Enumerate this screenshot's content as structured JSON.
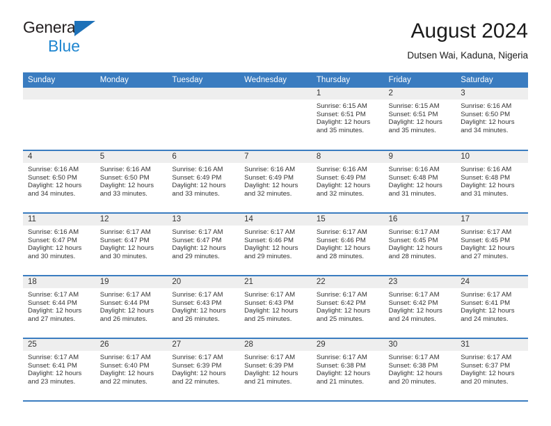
{
  "brand": {
    "line1": "General",
    "line2": "Blue",
    "logo_icon": "blue-triangle-logo"
  },
  "header": {
    "title": "August 2024",
    "location": "Dutsen Wai, Kaduna, Nigeria"
  },
  "colors": {
    "header_blue": "#3a7cc0",
    "brand_dark": "#231f20",
    "brand_blue": "#1f86d0",
    "daynum_band": "#eeeeee"
  },
  "weekday_headers": [
    "Sunday",
    "Monday",
    "Tuesday",
    "Wednesday",
    "Thursday",
    "Friday",
    "Saturday"
  ],
  "weeks": [
    [
      {
        "day": "",
        "empty": true,
        "sunrise": "",
        "sunset": "",
        "daylight1": "",
        "daylight2": ""
      },
      {
        "day": "",
        "empty": true,
        "sunrise": "",
        "sunset": "",
        "daylight1": "",
        "daylight2": ""
      },
      {
        "day": "",
        "empty": true,
        "sunrise": "",
        "sunset": "",
        "daylight1": "",
        "daylight2": ""
      },
      {
        "day": "",
        "empty": true,
        "sunrise": "",
        "sunset": "",
        "daylight1": "",
        "daylight2": ""
      },
      {
        "day": "1",
        "empty": false,
        "sunrise": "Sunrise: 6:15 AM",
        "sunset": "Sunset: 6:51 PM",
        "daylight1": "Daylight: 12 hours",
        "daylight2": "and 35 minutes."
      },
      {
        "day": "2",
        "empty": false,
        "sunrise": "Sunrise: 6:15 AM",
        "sunset": "Sunset: 6:51 PM",
        "daylight1": "Daylight: 12 hours",
        "daylight2": "and 35 minutes."
      },
      {
        "day": "3",
        "empty": false,
        "sunrise": "Sunrise: 6:16 AM",
        "sunset": "Sunset: 6:50 PM",
        "daylight1": "Daylight: 12 hours",
        "daylight2": "and 34 minutes."
      }
    ],
    [
      {
        "day": "4",
        "empty": false,
        "sunrise": "Sunrise: 6:16 AM",
        "sunset": "Sunset: 6:50 PM",
        "daylight1": "Daylight: 12 hours",
        "daylight2": "and 34 minutes."
      },
      {
        "day": "5",
        "empty": false,
        "sunrise": "Sunrise: 6:16 AM",
        "sunset": "Sunset: 6:50 PM",
        "daylight1": "Daylight: 12 hours",
        "daylight2": "and 33 minutes."
      },
      {
        "day": "6",
        "empty": false,
        "sunrise": "Sunrise: 6:16 AM",
        "sunset": "Sunset: 6:49 PM",
        "daylight1": "Daylight: 12 hours",
        "daylight2": "and 33 minutes."
      },
      {
        "day": "7",
        "empty": false,
        "sunrise": "Sunrise: 6:16 AM",
        "sunset": "Sunset: 6:49 PM",
        "daylight1": "Daylight: 12 hours",
        "daylight2": "and 32 minutes."
      },
      {
        "day": "8",
        "empty": false,
        "sunrise": "Sunrise: 6:16 AM",
        "sunset": "Sunset: 6:49 PM",
        "daylight1": "Daylight: 12 hours",
        "daylight2": "and 32 minutes."
      },
      {
        "day": "9",
        "empty": false,
        "sunrise": "Sunrise: 6:16 AM",
        "sunset": "Sunset: 6:48 PM",
        "daylight1": "Daylight: 12 hours",
        "daylight2": "and 31 minutes."
      },
      {
        "day": "10",
        "empty": false,
        "sunrise": "Sunrise: 6:16 AM",
        "sunset": "Sunset: 6:48 PM",
        "daylight1": "Daylight: 12 hours",
        "daylight2": "and 31 minutes."
      }
    ],
    [
      {
        "day": "11",
        "empty": false,
        "sunrise": "Sunrise: 6:16 AM",
        "sunset": "Sunset: 6:47 PM",
        "daylight1": "Daylight: 12 hours",
        "daylight2": "and 30 minutes."
      },
      {
        "day": "12",
        "empty": false,
        "sunrise": "Sunrise: 6:17 AM",
        "sunset": "Sunset: 6:47 PM",
        "daylight1": "Daylight: 12 hours",
        "daylight2": "and 30 minutes."
      },
      {
        "day": "13",
        "empty": false,
        "sunrise": "Sunrise: 6:17 AM",
        "sunset": "Sunset: 6:47 PM",
        "daylight1": "Daylight: 12 hours",
        "daylight2": "and 29 minutes."
      },
      {
        "day": "14",
        "empty": false,
        "sunrise": "Sunrise: 6:17 AM",
        "sunset": "Sunset: 6:46 PM",
        "daylight1": "Daylight: 12 hours",
        "daylight2": "and 29 minutes."
      },
      {
        "day": "15",
        "empty": false,
        "sunrise": "Sunrise: 6:17 AM",
        "sunset": "Sunset: 6:46 PM",
        "daylight1": "Daylight: 12 hours",
        "daylight2": "and 28 minutes."
      },
      {
        "day": "16",
        "empty": false,
        "sunrise": "Sunrise: 6:17 AM",
        "sunset": "Sunset: 6:45 PM",
        "daylight1": "Daylight: 12 hours",
        "daylight2": "and 28 minutes."
      },
      {
        "day": "17",
        "empty": false,
        "sunrise": "Sunrise: 6:17 AM",
        "sunset": "Sunset: 6:45 PM",
        "daylight1": "Daylight: 12 hours",
        "daylight2": "and 27 minutes."
      }
    ],
    [
      {
        "day": "18",
        "empty": false,
        "sunrise": "Sunrise: 6:17 AM",
        "sunset": "Sunset: 6:44 PM",
        "daylight1": "Daylight: 12 hours",
        "daylight2": "and 27 minutes."
      },
      {
        "day": "19",
        "empty": false,
        "sunrise": "Sunrise: 6:17 AM",
        "sunset": "Sunset: 6:44 PM",
        "daylight1": "Daylight: 12 hours",
        "daylight2": "and 26 minutes."
      },
      {
        "day": "20",
        "empty": false,
        "sunrise": "Sunrise: 6:17 AM",
        "sunset": "Sunset: 6:43 PM",
        "daylight1": "Daylight: 12 hours",
        "daylight2": "and 26 minutes."
      },
      {
        "day": "21",
        "empty": false,
        "sunrise": "Sunrise: 6:17 AM",
        "sunset": "Sunset: 6:43 PM",
        "daylight1": "Daylight: 12 hours",
        "daylight2": "and 25 minutes."
      },
      {
        "day": "22",
        "empty": false,
        "sunrise": "Sunrise: 6:17 AM",
        "sunset": "Sunset: 6:42 PM",
        "daylight1": "Daylight: 12 hours",
        "daylight2": "and 25 minutes."
      },
      {
        "day": "23",
        "empty": false,
        "sunrise": "Sunrise: 6:17 AM",
        "sunset": "Sunset: 6:42 PM",
        "daylight1": "Daylight: 12 hours",
        "daylight2": "and 24 minutes."
      },
      {
        "day": "24",
        "empty": false,
        "sunrise": "Sunrise: 6:17 AM",
        "sunset": "Sunset: 6:41 PM",
        "daylight1": "Daylight: 12 hours",
        "daylight2": "and 24 minutes."
      }
    ],
    [
      {
        "day": "25",
        "empty": false,
        "sunrise": "Sunrise: 6:17 AM",
        "sunset": "Sunset: 6:41 PM",
        "daylight1": "Daylight: 12 hours",
        "daylight2": "and 23 minutes."
      },
      {
        "day": "26",
        "empty": false,
        "sunrise": "Sunrise: 6:17 AM",
        "sunset": "Sunset: 6:40 PM",
        "daylight1": "Daylight: 12 hours",
        "daylight2": "and 22 minutes."
      },
      {
        "day": "27",
        "empty": false,
        "sunrise": "Sunrise: 6:17 AM",
        "sunset": "Sunset: 6:39 PM",
        "daylight1": "Daylight: 12 hours",
        "daylight2": "and 22 minutes."
      },
      {
        "day": "28",
        "empty": false,
        "sunrise": "Sunrise: 6:17 AM",
        "sunset": "Sunset: 6:39 PM",
        "daylight1": "Daylight: 12 hours",
        "daylight2": "and 21 minutes."
      },
      {
        "day": "29",
        "empty": false,
        "sunrise": "Sunrise: 6:17 AM",
        "sunset": "Sunset: 6:38 PM",
        "daylight1": "Daylight: 12 hours",
        "daylight2": "and 21 minutes."
      },
      {
        "day": "30",
        "empty": false,
        "sunrise": "Sunrise: 6:17 AM",
        "sunset": "Sunset: 6:38 PM",
        "daylight1": "Daylight: 12 hours",
        "daylight2": "and 20 minutes."
      },
      {
        "day": "31",
        "empty": false,
        "sunrise": "Sunrise: 6:17 AM",
        "sunset": "Sunset: 6:37 PM",
        "daylight1": "Daylight: 12 hours",
        "daylight2": "and 20 minutes."
      }
    ]
  ]
}
